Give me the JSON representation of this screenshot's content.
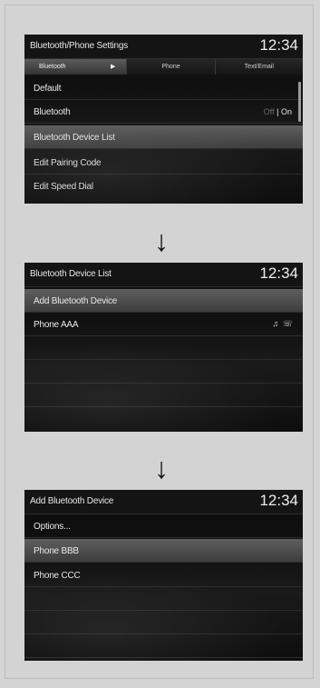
{
  "clock": "12:34",
  "screen1": {
    "title": "Bluetooth/Phone Settings",
    "tabs": [
      "Bluetooth",
      "Phone",
      "Text/Email"
    ],
    "items": [
      "Default",
      "Bluetooth",
      "Bluetooth Device List",
      "Edit Pairing Code",
      "Edit Speed Dial"
    ],
    "toggle_off": "Off",
    "toggle_sep": " | ",
    "toggle_on": "On",
    "selected_item": "Bluetooth Device List"
  },
  "arrow_glyph": "↓",
  "screen2": {
    "title": "Bluetooth Device List",
    "items": [
      "Add Bluetooth Device",
      "Phone AAA"
    ],
    "selected_item": "Add Bluetooth Device",
    "phone_icons": "♫ ☏"
  },
  "screen3": {
    "title": "Add Bluetooth Device",
    "items": [
      "Options...",
      "Phone BBB",
      "Phone CCC"
    ],
    "selected_item": "Phone BBB"
  }
}
